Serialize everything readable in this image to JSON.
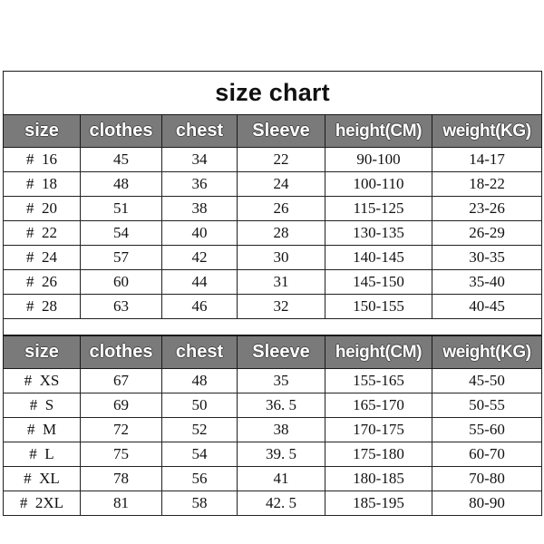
{
  "chart": {
    "title": "size chart",
    "columns": [
      "size",
      "clothes",
      "chest",
      "Sleeve",
      "height(CM)",
      "weight(KG)"
    ],
    "tables": [
      {
        "headers": [
          "size",
          "clothes",
          "chest",
          "Sleeve",
          "height(CM)",
          "weight(KG)"
        ],
        "rows": [
          [
            "#  16",
            "45",
            "34",
            "22",
            "90-100",
            "14-17"
          ],
          [
            "#  18",
            "48",
            "36",
            "24",
            "100-110",
            "18-22"
          ],
          [
            "#  20",
            "51",
            "38",
            "26",
            "115-125",
            "23-26"
          ],
          [
            "#  22",
            "54",
            "40",
            "28",
            "130-135",
            "26-29"
          ],
          [
            "#  24",
            "57",
            "42",
            "30",
            "140-145",
            "30-35"
          ],
          [
            "#  26",
            "60",
            "44",
            "31",
            "145-150",
            "35-40"
          ],
          [
            "#  28",
            "63",
            "46",
            "32",
            "150-155",
            "40-45"
          ]
        ]
      },
      {
        "headers": [
          "size",
          "clothes",
          "chest",
          "Sleeve",
          "height(CM)",
          "weight(KG)"
        ],
        "rows": [
          [
            "#  XS",
            "67",
            "48",
            "35",
            "155-165",
            "45-50"
          ],
          [
            "#  S",
            "69",
            "50",
            "36. 5",
            "165-170",
            "50-55"
          ],
          [
            "#  M",
            "72",
            "52",
            "38",
            "170-175",
            "55-60"
          ],
          [
            "#  L",
            "75",
            "54",
            "39. 5",
            "175-180",
            "60-70"
          ],
          [
            "#  XL",
            "78",
            "56",
            "41",
            "180-185",
            "70-80"
          ],
          [
            "#  2XL",
            "81",
            "58",
            "42. 5",
            "185-195",
            "80-90"
          ]
        ]
      }
    ],
    "colors": {
      "header_background": "#7a7a7a",
      "header_text": "#ffffff",
      "border": "#1a1a1a",
      "cell_background": "#ffffff",
      "cell_text": "#111111",
      "page_background": "#ffffff"
    }
  },
  "chart_data": {
    "type": "table",
    "title": "size chart",
    "columns": [
      "size",
      "clothes",
      "chest",
      "Sleeve",
      "height(CM)",
      "weight(KG)"
    ],
    "kids_sizes": {
      "size": [
        "# 16",
        "# 18",
        "# 20",
        "# 22",
        "# 24",
        "# 26",
        "# 28"
      ],
      "clothes": [
        45,
        48,
        51,
        54,
        57,
        60,
        63
      ],
      "chest": [
        34,
        36,
        38,
        40,
        42,
        44,
        46
      ],
      "sleeve": [
        22,
        24,
        26,
        28,
        30,
        31,
        32
      ],
      "height_cm": [
        "90-100",
        "100-110",
        "115-125",
        "130-135",
        "140-145",
        "145-150",
        "150-155"
      ],
      "weight_kg": [
        "14-17",
        "18-22",
        "23-26",
        "26-29",
        "30-35",
        "35-40",
        "40-45"
      ]
    },
    "adult_sizes": {
      "size": [
        "# XS",
        "# S",
        "# M",
        "# L",
        "# XL",
        "# 2XL"
      ],
      "clothes": [
        67,
        69,
        72,
        75,
        78,
        81
      ],
      "chest": [
        48,
        50,
        52,
        54,
        56,
        58
      ],
      "sleeve": [
        35,
        36.5,
        38,
        39.5,
        41,
        42.5
      ],
      "height_cm": [
        "155-165",
        "165-170",
        "170-175",
        "175-180",
        "180-185",
        "185-195"
      ],
      "weight_kg": [
        "45-50",
        "50-55",
        "55-60",
        "60-70",
        "70-80",
        "80-90"
      ]
    }
  }
}
